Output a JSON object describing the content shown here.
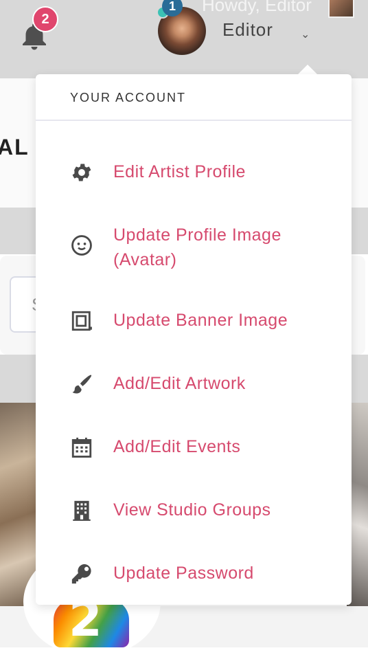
{
  "header": {
    "notifications_count": "2",
    "user_badge_count": "1",
    "greeting": "Howdy, Editor",
    "username": "Editor",
    "chevron_glyph": "⌄"
  },
  "background": {
    "hero_text": "AL E",
    "search_letter": "S",
    "bottom_number": "2"
  },
  "dropdown": {
    "title": "YOUR ACCOUNT",
    "items": [
      {
        "label": "Edit Artist Profile",
        "icon": "gear-icon"
      },
      {
        "label": "Update Profile Image (Avatar)",
        "icon": "smiley-face-icon"
      },
      {
        "label": "Update Banner Image",
        "icon": "banner-frame-icon"
      },
      {
        "label": "Add/Edit Artwork",
        "icon": "paintbrush-icon"
      },
      {
        "label": "Add/Edit Events",
        "icon": "calendar-icon"
      },
      {
        "label": "View Studio Groups",
        "icon": "building-icon"
      },
      {
        "label": "Update Password",
        "icon": "key-icon"
      }
    ]
  },
  "colors": {
    "accent": "#d64a6e",
    "badge_pink": "#e0466d",
    "badge_blue": "#2a6c97",
    "icon_grey": "#4a4a4a"
  }
}
